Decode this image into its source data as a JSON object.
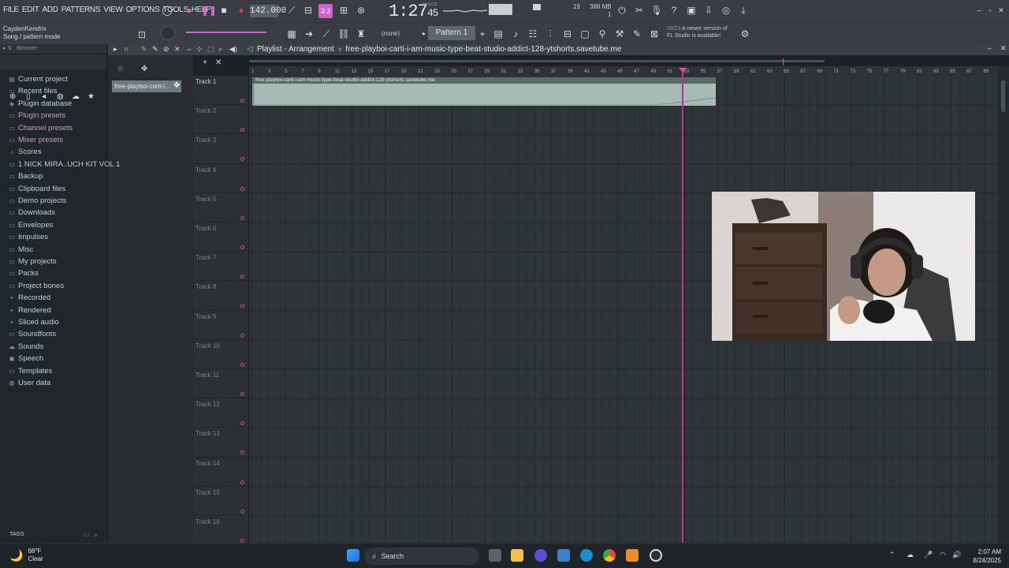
{
  "menu": [
    "FILE",
    "EDIT",
    "ADD",
    "PATTERNS",
    "VIEW",
    "OPTIONS",
    "TOOLS",
    "HELP"
  ],
  "transport": {
    "tempo": "142.000",
    "pattern_song_label": "3:2",
    "time_main": "1:27",
    "time_sub": "45",
    "time_label": "M:S:CS",
    "memory": "388 MB",
    "memory_sub": "1",
    "cpu": "19"
  },
  "hint": {
    "user": "CaydenKendrix",
    "mode": "Song / pattern mode"
  },
  "toolbar2": {
    "none_label": "(none)",
    "pattern": "Pattern 1",
    "news_date": "08/23",
    "news_text_1": "A newer version of",
    "news_text_2": "FL Studio is available!"
  },
  "browser": {
    "header": "Browser",
    "items": [
      {
        "label": "Current project",
        "icon": "project-icon",
        "pink": false
      },
      {
        "label": "Recent files",
        "icon": "folder-icon",
        "pink": false
      },
      {
        "label": "Plugin database",
        "icon": "plugin-icon",
        "pink": false
      },
      {
        "label": "Plugin presets",
        "icon": "preset-icon",
        "pink": true
      },
      {
        "label": "Channel presets",
        "icon": "preset-icon",
        "pink": true
      },
      {
        "label": "Mixer presets",
        "icon": "preset-icon",
        "pink": true
      },
      {
        "label": "Scores",
        "icon": "note-icon",
        "pink": false
      },
      {
        "label": "1 NICK MIRA..UCH KIT VOL 1",
        "icon": "folder-icon",
        "pink": false
      },
      {
        "label": "Backup",
        "icon": "folder-icon",
        "pink": false
      },
      {
        "label": "Clipboard files",
        "icon": "folder-icon",
        "pink": false
      },
      {
        "label": "Demo projects",
        "icon": "folder-icon",
        "pink": false
      },
      {
        "label": "Downloads",
        "icon": "folder-icon",
        "pink": false
      },
      {
        "label": "Envelopes",
        "icon": "folder-icon",
        "pink": false
      },
      {
        "label": "Impulses",
        "icon": "folder-icon",
        "pink": false
      },
      {
        "label": "Misc",
        "icon": "folder-icon",
        "pink": false
      },
      {
        "label": "My projects",
        "icon": "folder-icon",
        "pink": false
      },
      {
        "label": "Packs",
        "icon": "folder-icon",
        "pink": false
      },
      {
        "label": "Project bones",
        "icon": "folder-icon",
        "pink": false
      },
      {
        "label": "Recorded",
        "icon": "plus-icon",
        "pink": false
      },
      {
        "label": "Rendered",
        "icon": "plus-icon",
        "pink": false
      },
      {
        "label": "Sliced audio",
        "icon": "plus-icon",
        "pink": false
      },
      {
        "label": "Soundfonts",
        "icon": "folder-icon",
        "pink": false
      },
      {
        "label": "Sounds",
        "icon": "cloud-icon",
        "pink": false
      },
      {
        "label": "Speech",
        "icon": "speech-icon",
        "pink": false
      },
      {
        "label": "Templates",
        "icon": "folder-icon",
        "pink": false
      },
      {
        "label": "User data",
        "icon": "user-icon",
        "pink": false
      }
    ],
    "tags_label": "TAGS"
  },
  "playlist": {
    "title_prefix": "Playlist - Arrangement",
    "title_file": "free-playboi-carti-i-am-music-type-beat-studio-addict-128-ytshorts.savetube.me",
    "pattern_clip": "free-playboi-carti-i...",
    "audio_clip_label": "free-playboi-carti-i-am-music-type-beat-studio-addict-128-ytshorts.savetube.me",
    "tracks": [
      "Track 1",
      "Track 2",
      "Track 3",
      "Track 4",
      "Track 5",
      "Track 6",
      "Track 7",
      "Track 8",
      "Track 9",
      "Track 10",
      "Track 11",
      "Track 12",
      "Track 13",
      "Track 14",
      "Track 15",
      "Track 16"
    ],
    "ruler": [
      "1",
      "3",
      "5",
      "7",
      "9",
      "11",
      "13",
      "15",
      "17",
      "19",
      "21",
      "23",
      "25",
      "27",
      "29",
      "31",
      "33",
      "35",
      "37",
      "39",
      "41",
      "43",
      "45",
      "47",
      "49",
      "51",
      "53",
      "55",
      "57",
      "59",
      "61",
      "63",
      "65",
      "67",
      "69",
      "71",
      "73",
      "75",
      "77",
      "79",
      "81",
      "83",
      "85",
      "87",
      "89"
    ]
  },
  "taskbar": {
    "temp": "68°F",
    "weather": "Clear",
    "search": "Search",
    "time": "2:07 AM",
    "date": "8/24/2025"
  },
  "colors": {
    "accent_pink": "#d664c6",
    "playhead": "#b3358e",
    "audio_clip": "#a7bbb5"
  }
}
